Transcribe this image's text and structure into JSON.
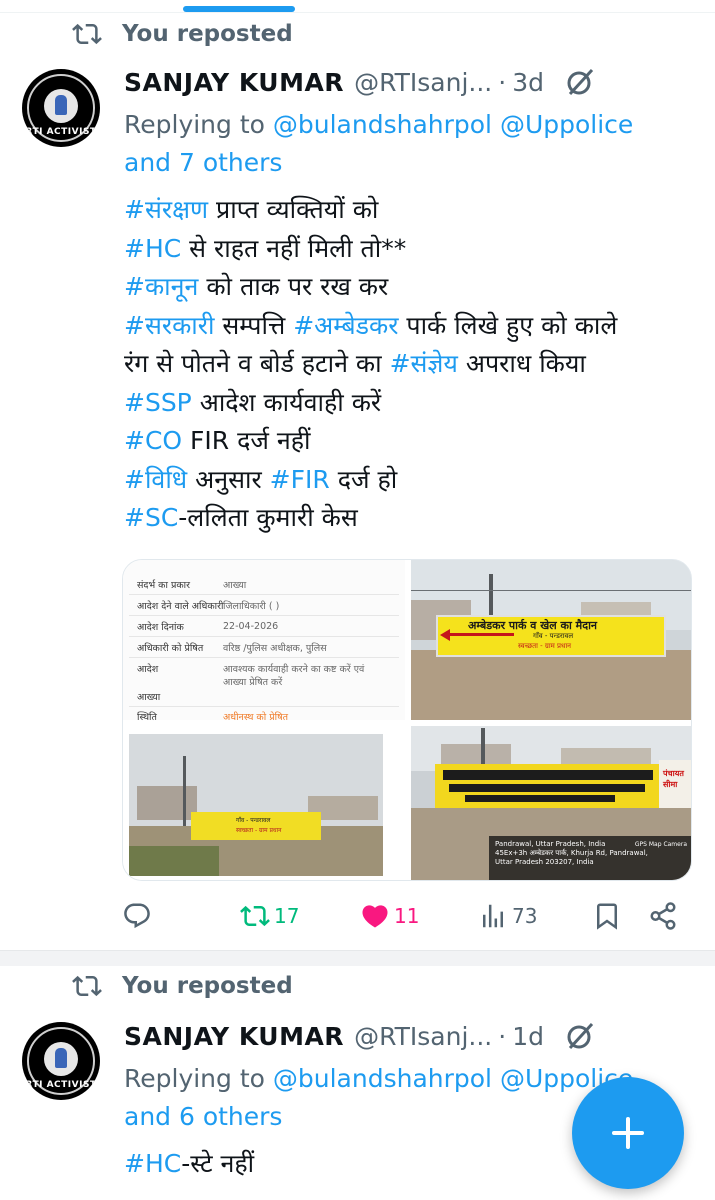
{
  "colors": {
    "accent": "#1d9bf0",
    "retweet": "#00ba7c",
    "like": "#f91880",
    "muted": "#536471"
  },
  "posts": [
    {
      "repost_label": "You reposted",
      "author": {
        "name": "SANJAY KUMAR",
        "handle": "@RTIsanj...",
        "dot": "·",
        "time": "3d",
        "avatar_text": "RTI ACTIVIST"
      },
      "reply": {
        "prefix": "Replying to ",
        "mentions": "@bulandshahrpol @Uppolice",
        "others": "and 7 others"
      },
      "lines": [
        {
          "tag": "#संरक्षण",
          "text": " प्राप्त व्यक्तियों को"
        },
        {
          "tag": "#HC",
          "text": " से राहत नहीं मिली तो**"
        },
        {
          "tag": "#कानून",
          "text": " को ताक पर रख कर"
        },
        {
          "tag": "#सरकारी",
          "text": " सम्पत्ति ",
          "tag2": "#अम्बेडकर",
          "text2": " पार्क लिखे हुए को काले"
        },
        {
          "text": "रंग से पोतने व बोर्ड हटाने का ",
          "tag2": "#संज्ञेय",
          "text2": " अपराध किया"
        },
        {
          "tag": "#SSP",
          "text": " आदेश कार्यवाही करें"
        },
        {
          "tag": "#CO",
          "text": " FIR दर्ज नहीं"
        },
        {
          "tag": "#विधि",
          "text": " अनुसार ",
          "tag2": "#FIR",
          "text2": " दर्ज हो"
        },
        {
          "tag": "#SC",
          "text": "-ललिता कुमारी केस"
        }
      ],
      "media": {
        "form": [
          {
            "k": "संदर्भ का प्रकार",
            "v": "आख्या"
          },
          {
            "k": "आदेश देने वाले अधिकारी",
            "v": "जिलाधिकारी ( )"
          },
          {
            "k": "आदेश दिनांक",
            "v": "22-04-2026"
          },
          {
            "k": "अधिकारी को प्रेषित",
            "v": "वरिष्ठ /पुलिस अधीक्षक, पुलिस"
          },
          {
            "k": "आदेश",
            "v": "आवश्यक कार्यवाही करने का कष्ट करें एवं"
          },
          {
            "k": "",
            "v": "आख्या प्रेषित करें"
          },
          {
            "k": "आख्या",
            "v": ""
          },
          {
            "k": "स्थिति",
            "v": "अधीनस्थ को प्रेषित"
          }
        ],
        "board_title": "अम्बेडकर पार्क व खेल का मैदान",
        "board_line2": "गाँव - पन्डरावल",
        "board_line3": "स्वच्छता - ग्राम प्रधान",
        "side_board": "पंचायत सीमा",
        "gps_badge": "GPS Map Camera",
        "gps_lines": [
          "Pandrawal, Uttar Pradesh, India",
          "45Ex+3h अम्बेडकर पार्क, Khurja Rd, Pandrawal,",
          "Uttar Pradesh 203207, India"
        ]
      },
      "actions": {
        "retweets": "17",
        "likes": "11",
        "views": "73"
      }
    },
    {
      "repost_label": "You reposted",
      "author": {
        "name": "SANJAY KUMAR",
        "handle": "@RTIsanj...",
        "dot": "·",
        "time": "1d",
        "avatar_text": "RTI ACTIVIST"
      },
      "reply": {
        "prefix": "Replying to ",
        "mentions": "@bulandshahrpol @Uppolice",
        "others": "and 6 others"
      },
      "lines": [
        {
          "tag": "#HC",
          "text": "-स्टे नहीं"
        }
      ]
    }
  ]
}
